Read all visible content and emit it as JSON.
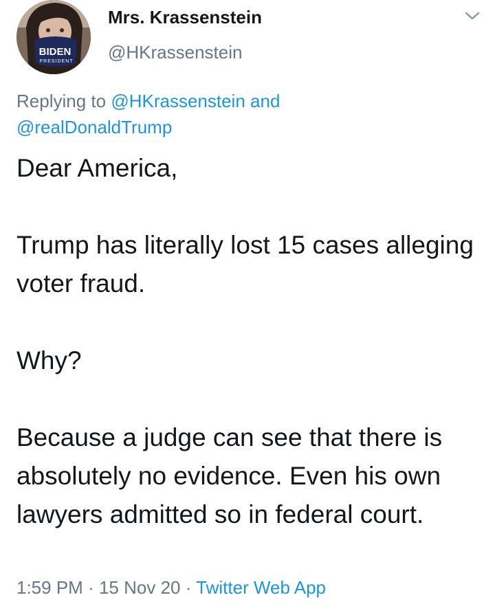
{
  "author": {
    "name": "Mrs. Krassenstein",
    "handle": "@HKrassenstein",
    "mask_text": "BIDEN",
    "mask_subtext": "PRESIDENT"
  },
  "menu_icon": "chevron-down-icon",
  "reply": {
    "prefix": "Replying to",
    "mention_1": "@HKrassenstein",
    "conjunction": "and",
    "mention_2": "@realDonaldTrump"
  },
  "body": {
    "line_1": "Dear America,",
    "line_2": "Trump has literally lost 15 cases alleging voter fraud.",
    "line_3": "Why?",
    "line_4": "Because a judge can see that there is absolutely no evidence. Even his own lawyers admitted so in federal court."
  },
  "meta": {
    "time": "1:59 PM",
    "separator": "·",
    "date": "15 Nov 20",
    "source": "Twitter Web App"
  },
  "colors": {
    "text": "#14171a",
    "secondary": "#657786",
    "link": "#1b95e0"
  }
}
